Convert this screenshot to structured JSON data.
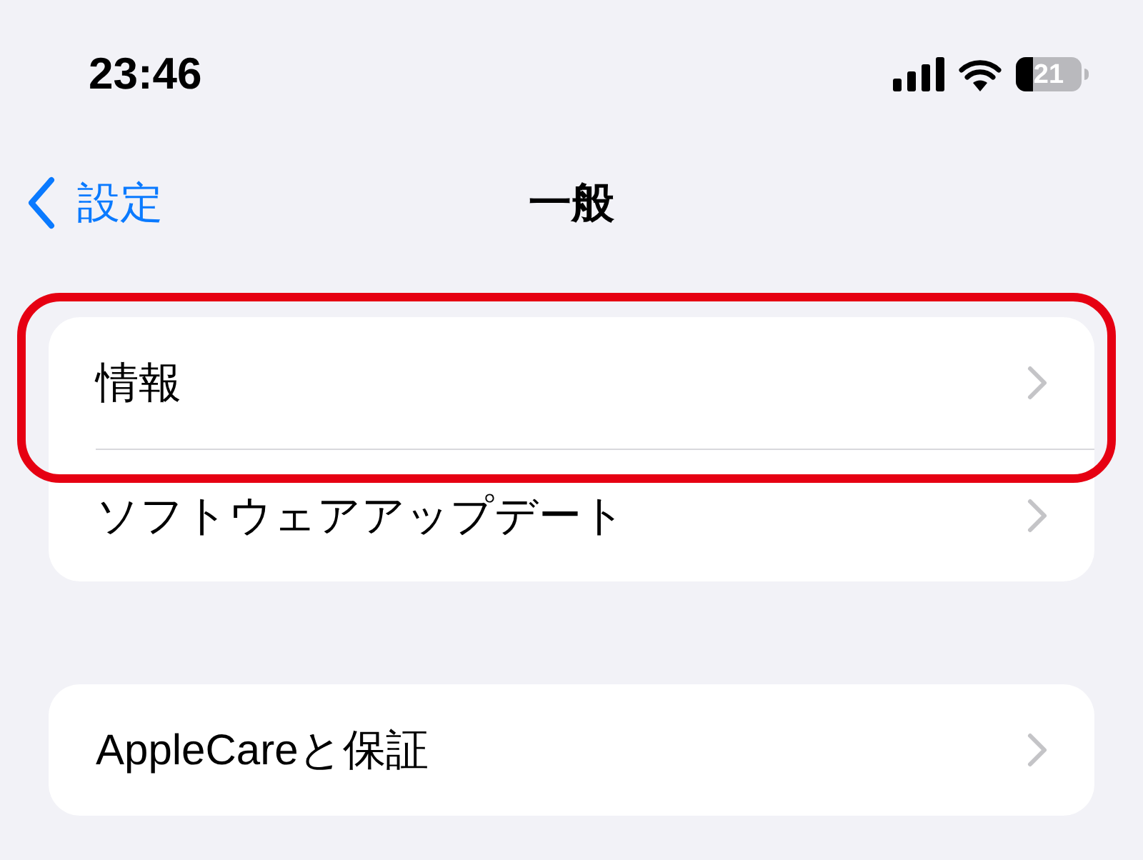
{
  "status_bar": {
    "time": "23:46",
    "battery": "21"
  },
  "nav": {
    "back": "設定",
    "title": "一般"
  },
  "groups": [
    {
      "items": [
        {
          "label": "情報",
          "highlighted": true
        },
        {
          "label": "ソフトウェアアップデート",
          "highlighted": false
        }
      ]
    },
    {
      "items": [
        {
          "label": "AppleCareと保証",
          "highlighted": false
        }
      ]
    }
  ]
}
